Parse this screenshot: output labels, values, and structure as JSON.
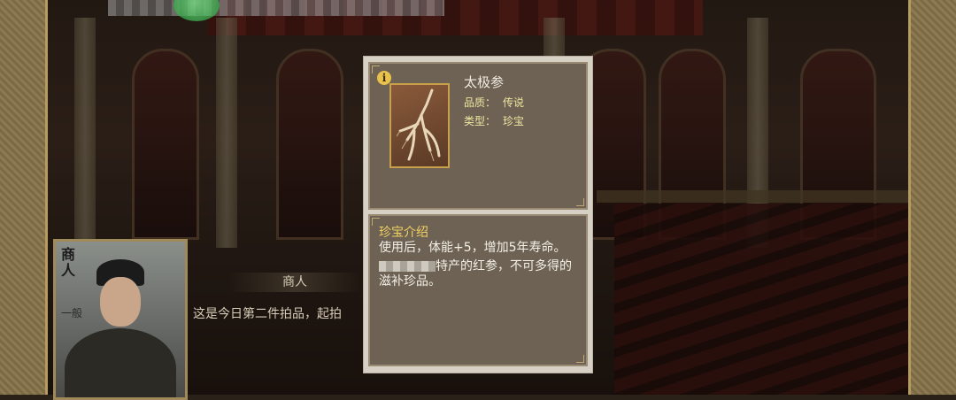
{
  "merchant": {
    "title": "商人",
    "rank": "一般",
    "speaker_name": "商人",
    "dialog_text": "这是今日第二件拍品，起拍"
  },
  "item_popup": {
    "name": "太极参",
    "quality_label": "品质：",
    "quality_value": "传说",
    "type_label": "类型：",
    "type_value": "珍宝",
    "section_title": "珍宝介绍",
    "description_line1": "使用后，体能+5，增加5年寿命。",
    "description_line2_suffix": "特产的红参，不可多得的滋补珍品。",
    "info_icon_symbol": "i"
  },
  "colors": {
    "quality_text": "#f0e6a0",
    "section_title": "#f0d060",
    "panel_bg": "#6d6254",
    "popup_border": "#d7d1c5",
    "item_frame": "#c8a04a"
  }
}
